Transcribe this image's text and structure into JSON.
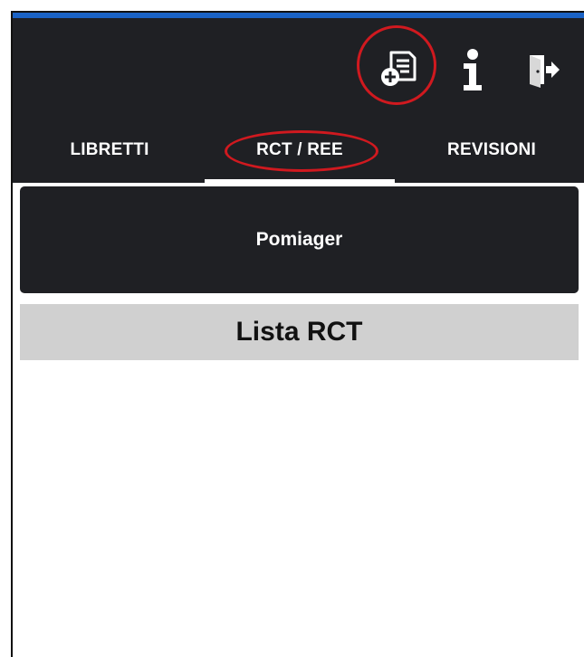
{
  "header": {
    "toolbar": {
      "new_document_icon": "document-add-icon",
      "info_icon": "info-icon",
      "exit_icon": "exit-icon"
    },
    "tabs": [
      {
        "label": "LIBRETTI",
        "active": false
      },
      {
        "label": "RCT / REE",
        "active": true
      },
      {
        "label": "REVISIONI",
        "active": false
      }
    ]
  },
  "company": {
    "name": "Pomiager"
  },
  "list": {
    "title": "Lista RCT"
  },
  "colors": {
    "accent_bar": "#1b63c6",
    "header_bg": "#1f2024",
    "highlight": "#d0191f",
    "list_header_bg": "#d0d0d0"
  }
}
